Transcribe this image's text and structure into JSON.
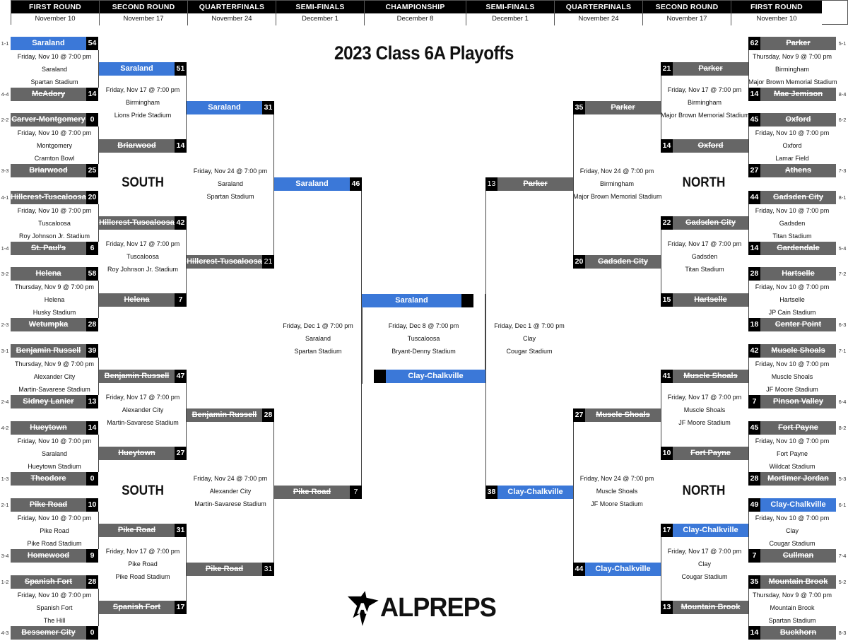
{
  "title": "2023 Class 6A Playoffs",
  "header": [
    {
      "round": "FIRST ROUND",
      "date": "November 10"
    },
    {
      "round": "SECOND ROUND",
      "date": "November 17"
    },
    {
      "round": "QUARTERFINALS",
      "date": "November 24"
    },
    {
      "round": "SEMI-FINALS",
      "date": "December 1"
    },
    {
      "round": "CHAMPIONSHIP",
      "date": "December 8"
    },
    {
      "round": "SEMI-FINALS",
      "date": "December 1"
    },
    {
      "round": "QUARTERFINALS",
      "date": "November 24"
    },
    {
      "round": "SECOND ROUND",
      "date": "November 17"
    },
    {
      "round": "FIRST ROUND",
      "date": "November 10"
    }
  ],
  "regions": {
    "south_top": "SOUTH",
    "south_bottom": "SOUTH",
    "north_top": "NORTH",
    "north_bottom": "NORTH"
  },
  "logo": "ALPREPS",
  "colors": {
    "winner": "#3b78d8",
    "loser": "#666666",
    "score_bg": "#000000"
  },
  "left": {
    "r1": [
      {
        "top": {
          "seed": "1-1",
          "name": "Saraland",
          "score": "54",
          "status": "win"
        },
        "bottom": {
          "seed": "4-4",
          "name": "McAdory",
          "score": "14",
          "status": "lose"
        },
        "date": "Friday, Nov 10 @ 7:00 pm",
        "city": "Saraland",
        "venue": "Spartan Stadium"
      },
      {
        "top": {
          "seed": "2-2",
          "name": "Carver-Montgomery",
          "score": "0",
          "status": "lose"
        },
        "bottom": {
          "seed": "3-3",
          "name": "Briarwood",
          "score": "25",
          "status": "lose"
        },
        "date": "Friday, Nov 10 @ 7:00 pm",
        "city": "Montgomery",
        "venue": "Cramton Bowl"
      },
      {
        "top": {
          "seed": "4-1",
          "name": "Hillcrest-Tuscaloosa",
          "score": "20",
          "status": "lose"
        },
        "bottom": {
          "seed": "1-4",
          "name": "St. Paul's",
          "score": "6",
          "status": "lose"
        },
        "date": "Friday, Nov 10 @ 7:00 pm",
        "city": "Tuscaloosa",
        "venue": "Roy Johnson Jr. Stadium"
      },
      {
        "top": {
          "seed": "3-2",
          "name": "Helena",
          "score": "58",
          "status": "lose"
        },
        "bottom": {
          "seed": "2-3",
          "name": "Wetumpka",
          "score": "28",
          "status": "lose"
        },
        "date": "Thursday, Nov 9 @ 7:00 pm",
        "city": "Helena",
        "venue": "Husky Stadium"
      },
      {
        "top": {
          "seed": "3-1",
          "name": "Benjamin Russell",
          "score": "39",
          "status": "lose"
        },
        "bottom": {
          "seed": "2-4",
          "name": "Sidney Lanier",
          "score": "13",
          "status": "lose"
        },
        "date": "Thursday, Nov 9 @ 7:00 pm",
        "city": "Alexander City",
        "venue": "Martin-Savarese Stadium"
      },
      {
        "top": {
          "seed": "4-2",
          "name": "Hueytown",
          "score": "14",
          "status": "lose"
        },
        "bottom": {
          "seed": "1-3",
          "name": "Theodore",
          "score": "0",
          "status": "lose"
        },
        "date": "Friday, Nov 10 @ 7:00 pm",
        "city": "Saraland",
        "venue": "Hueytown Stadium"
      },
      {
        "top": {
          "seed": "2-1",
          "name": "Pike Road",
          "score": "10",
          "status": "lose"
        },
        "bottom": {
          "seed": "3-4",
          "name": "Homewood",
          "score": "9",
          "status": "lose"
        },
        "date": "Friday, Nov 10 @ 7:00 pm",
        "city": "Pike Road",
        "venue": "Pike Road Stadium"
      },
      {
        "top": {
          "seed": "1-2",
          "name": "Spanish Fort",
          "score": "28",
          "status": "lose"
        },
        "bottom": {
          "seed": "4-3",
          "name": "Bessemer City",
          "score": "0",
          "status": "lose"
        },
        "date": "Friday, Nov 10 @ 7:00 pm",
        "city": "Spanish Fort",
        "venue": "The Hill"
      }
    ],
    "r2": [
      {
        "top": {
          "name": "Saraland",
          "score": "51",
          "status": "win"
        },
        "bottom": {
          "name": "Briarwood",
          "score": "14",
          "status": "lose"
        },
        "date": "Friday, Nov 17 @ 7:00 pm",
        "city": "Birmingham",
        "venue": "Lions Pride Stadium"
      },
      {
        "top": {
          "name": "Hillcrest-Tuscaloosa",
          "score": "42",
          "status": "lose"
        },
        "bottom": {
          "name": "Helena",
          "score": "7",
          "status": "lose"
        },
        "date": "Friday, Nov 17 @ 7:00 pm",
        "city": "Tuscaloosa",
        "venue": "Roy Johnson Jr. Stadium"
      },
      {
        "top": {
          "name": "Benjamin Russell",
          "score": "47",
          "status": "lose"
        },
        "bottom": {
          "name": "Hueytown",
          "score": "27",
          "status": "lose"
        },
        "date": "Friday, Nov 17 @ 7:00 pm",
        "city": "Alexander City",
        "venue": "Martin-Savarese Stadium"
      },
      {
        "top": {
          "name": "Pike Road",
          "score": "31",
          "status": "lose"
        },
        "bottom": {
          "name": "Spanish Fort",
          "score": "17",
          "status": "lose"
        },
        "date": "Friday, Nov 17 @ 7:00 pm",
        "city": "Pike Road",
        "venue": "Pike Road Stadium"
      }
    ],
    "qf": [
      {
        "top": {
          "name": "Saraland",
          "score": "31",
          "status": "win"
        },
        "bottom": {
          "name": "Hillcrest-Tuscaloosa",
          "score": "21",
          "status": "lose"
        },
        "date": "Friday, Nov 24 @ 7:00 pm",
        "city": "Saraland",
        "venue": "Spartan Stadium"
      },
      {
        "top": {
          "name": "Benjamin Russell",
          "score": "28",
          "status": "lose"
        },
        "bottom": {
          "name": "Pike Road",
          "score": "31",
          "status": "lose"
        },
        "date": "Friday, Nov 24 @ 7:00 pm",
        "city": "Alexander City",
        "venue": "Martin-Savarese Stadium"
      }
    ],
    "sf": {
      "top": {
        "name": "Saraland",
        "score": "46",
        "status": "win"
      },
      "bottom": {
        "name": "Pike Road",
        "score": "7",
        "status": "lose"
      },
      "date": "Friday, Dec 1 @ 7:00 pm",
      "city": "Saraland",
      "venue": "Spartan Stadium"
    }
  },
  "right": {
    "r1": [
      {
        "top": {
          "seed": "5-1",
          "name": "Parker",
          "score": "62",
          "status": "lose"
        },
        "bottom": {
          "seed": "8-4",
          "name": "Mae Jemison",
          "score": "14",
          "status": "lose"
        },
        "date": "Thursday, Nov 9 @ 7:00 pm",
        "city": "Birmingham",
        "venue": "Major Brown Memorial Stadium"
      },
      {
        "top": {
          "seed": "6-2",
          "name": "Oxford",
          "score": "45",
          "status": "lose"
        },
        "bottom": {
          "seed": "7-3",
          "name": "Athens",
          "score": "27",
          "status": "lose"
        },
        "date": "Friday, Nov 10 @ 7:00 pm",
        "city": "Oxford",
        "venue": "Lamar Field"
      },
      {
        "top": {
          "seed": "8-1",
          "name": "Gadsden City",
          "score": "44",
          "status": "lose"
        },
        "bottom": {
          "seed": "5-4",
          "name": "Gardendale",
          "score": "14",
          "status": "lose"
        },
        "date": "Friday, Nov 10 @ 7:00 pm",
        "city": "Gadsden",
        "venue": "Titan Stadium"
      },
      {
        "top": {
          "seed": "7-2",
          "name": "Hartselle",
          "score": "28",
          "status": "lose"
        },
        "bottom": {
          "seed": "6-3",
          "name": "Center Point",
          "score": "18",
          "status": "lose"
        },
        "date": "Friday, Nov 10 @ 7:00 pm",
        "city": "Hartselle",
        "venue": "JP Cain Stadium"
      },
      {
        "top": {
          "seed": "7-1",
          "name": "Muscle Shoals",
          "score": "42",
          "status": "lose"
        },
        "bottom": {
          "seed": "6-4",
          "name": "Pinson Valley",
          "score": "7",
          "status": "lose"
        },
        "date": "Friday, Nov 10 @ 7:00 pm",
        "city": "Muscle Shoals",
        "venue": "JF Moore Stadium"
      },
      {
        "top": {
          "seed": "8-2",
          "name": "Fort Payne",
          "score": "45",
          "status": "lose"
        },
        "bottom": {
          "seed": "5-3",
          "name": "Mortimer Jordan",
          "score": "28",
          "status": "lose"
        },
        "date": "Friday, Nov 10 @ 7:00 pm",
        "city": "Fort Payne",
        "venue": "Wildcat Stadium"
      },
      {
        "top": {
          "seed": "6-1",
          "name": "Clay-Chalkville",
          "score": "49",
          "status": "win"
        },
        "bottom": {
          "seed": "7-4",
          "name": "Cullman",
          "score": "7",
          "status": "lose"
        },
        "date": "Friday, Nov 10 @ 7:00 pm",
        "city": "Clay",
        "venue": "Cougar Stadium"
      },
      {
        "top": {
          "seed": "5-2",
          "name": "Mountain Brook",
          "score": "35",
          "status": "lose"
        },
        "bottom": {
          "seed": "8-3",
          "name": "Buckhorn",
          "score": "14",
          "status": "lose"
        },
        "date": "Thursday, Nov 9 @ 7:00 pm",
        "city": "Mountain Brook",
        "venue": "Spartan Stadium"
      }
    ],
    "r2": [
      {
        "top": {
          "name": "Parker",
          "score": "21",
          "status": "lose"
        },
        "bottom": {
          "name": "Oxford",
          "score": "14",
          "status": "lose"
        },
        "date": "Friday, Nov 17 @ 7:00 pm",
        "city": "Birmingham",
        "venue": "Major Brown Memorial Stadium"
      },
      {
        "top": {
          "name": "Gadsden City",
          "score": "22",
          "status": "lose"
        },
        "bottom": {
          "name": "Hartselle",
          "score": "15",
          "status": "lose"
        },
        "date": "Friday, Nov 17 @ 7:00 pm",
        "city": "Gadsden",
        "venue": "Titan Stadium"
      },
      {
        "top": {
          "name": "Muscle Shoals",
          "score": "41",
          "status": "lose"
        },
        "bottom": {
          "name": "Fort Payne",
          "score": "10",
          "status": "lose"
        },
        "date": "Friday, Nov 17 @ 7:00 pm",
        "city": "Muscle Shoals",
        "venue": "JF Moore Stadium"
      },
      {
        "top": {
          "name": "Clay-Chalkville",
          "score": "17",
          "status": "win"
        },
        "bottom": {
          "name": "Mountain Brook",
          "score": "13",
          "status": "lose"
        },
        "date": "Friday, Nov 17 @ 7:00 pm",
        "city": "Clay",
        "venue": "Cougar Stadium"
      }
    ],
    "qf": [
      {
        "top": {
          "name": "Parker",
          "score": "35",
          "status": "lose"
        },
        "bottom": {
          "name": "Gadsden City",
          "score": "20",
          "status": "lose"
        },
        "date": "Friday, Nov 24 @ 7:00 pm",
        "city": "Birmingham",
        "venue": "Major Brown Memorial Stadium"
      },
      {
        "top": {
          "name": "Muscle Shoals",
          "score": "27",
          "status": "lose"
        },
        "bottom": {
          "name": "Clay-Chalkville",
          "score": "44",
          "status": "win"
        },
        "date": "Friday, Nov 24 @ 7:00 pm",
        "city": "Muscle Shoals",
        "venue": "JF Moore Stadium"
      }
    ],
    "sf": {
      "top": {
        "name": "Parker",
        "score": "13",
        "status": "lose"
      },
      "bottom": {
        "name": "Clay-Chalkville",
        "score": "38",
        "status": "win"
      },
      "date": "Friday, Dec 1 @ 7:00 pm",
      "city": "Clay",
      "venue": "Cougar Stadium"
    }
  },
  "championship": {
    "top": {
      "name": "Saraland",
      "score": "",
      "status": "tbd"
    },
    "bottom": {
      "name": "Clay-Chalkville",
      "score": "",
      "status": "tbd"
    },
    "date": "Friday, Dec 8 @ 7:00 pm",
    "city": "Tuscaloosa",
    "venue": "Bryant-Denny Stadium"
  }
}
